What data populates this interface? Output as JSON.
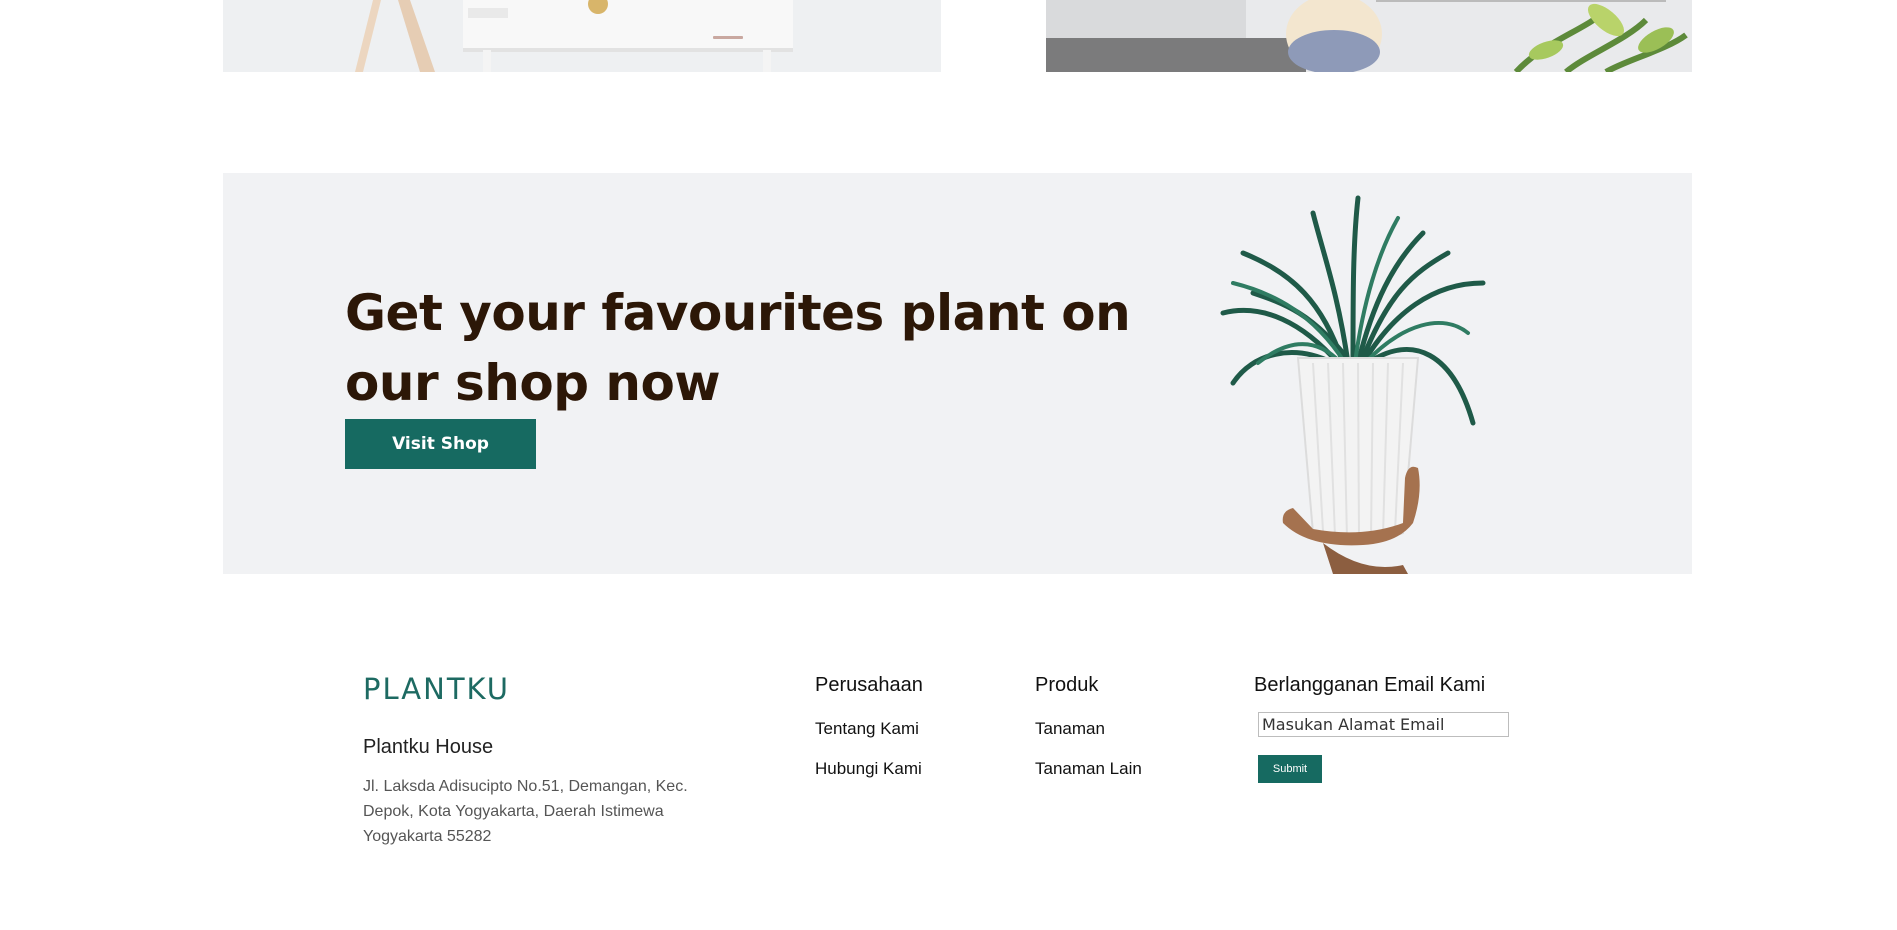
{
  "banner": {
    "title": "Get your favourites plant on our shop now",
    "button_label": "Visit Shop"
  },
  "footer": {
    "brand": "PLANTKU",
    "house_name": "Plantku House",
    "address": "Jl. Laksda Adisucipto No.51, Demangan, Kec. Depok, Kota Yogyakarta, Daerah Istimewa Yogyakarta 55282",
    "company": {
      "title": "Perusahaan",
      "links": [
        "Tentang Kami",
        "Hubungi Kami"
      ]
    },
    "product": {
      "title": "Produk",
      "links": [
        "Tanaman",
        "Tanaman Lain"
      ]
    },
    "newsletter": {
      "title": "Berlangganan Email Kami",
      "placeholder": "Masukan Alamat Email",
      "submit_label": "Submit"
    }
  },
  "colors": {
    "accent": "#166a61",
    "heading": "#2c1707",
    "banner_bg": "#f1f2f4"
  }
}
